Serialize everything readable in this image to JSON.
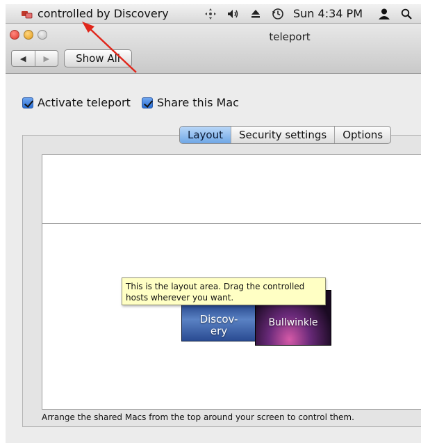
{
  "menubar": {
    "teleport_status": "controlled by Discovery",
    "clock": "Sun 4:34 PM",
    "icons": [
      "teleport-icon",
      "move-icon",
      "volume-icon",
      "eject-icon",
      "time-machine-icon",
      "user-icon",
      "spotlight-icon"
    ]
  },
  "window": {
    "title": "teleport",
    "show_all_label": "Show All",
    "nav_back_glyph": "◀",
    "nav_forward_glyph": "▶"
  },
  "options": {
    "activate_label": "Activate teleport",
    "activate_checked": true,
    "share_label": "Share this Mac",
    "share_checked": true
  },
  "tabs": [
    {
      "label": "Layout",
      "active": true
    },
    {
      "label": "Security settings",
      "active": false
    },
    {
      "label": "Options",
      "active": false
    }
  ],
  "layout": {
    "tooltip": "This is the layout area. Drag the controlled hosts wherever you want.",
    "hosts": [
      {
        "label": "Discov-\nery"
      },
      {
        "label": "Bullwinkle"
      }
    ],
    "footer": "Arrange the shared Macs from the top around your screen to control them."
  },
  "colors": {
    "accent": "#6fa7e6",
    "tooltip_bg": "#ffffc4",
    "annotation_arrow": "#e0261b"
  }
}
